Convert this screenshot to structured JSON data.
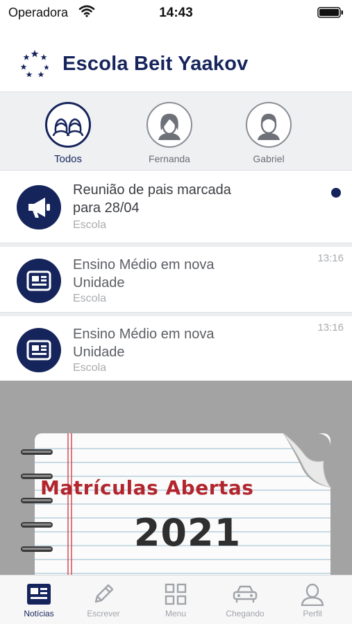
{
  "status_bar": {
    "carrier": "Operadora",
    "time": "14:43"
  },
  "header": {
    "title": "Escola Beit Yaakov",
    "logo_icon": "stars-logo-icon"
  },
  "filters": [
    {
      "label": "Todos",
      "icon": "group-avatar-icon",
      "active": true
    },
    {
      "label": "Fernanda",
      "icon": "girl-avatar-icon",
      "active": false
    },
    {
      "label": "Gabriel",
      "icon": "boy-avatar-icon",
      "active": false
    }
  ],
  "news": [
    {
      "title_line1": "Reunião de pais marcada",
      "title_line2": "para 28/04",
      "source": "Escola",
      "time": "",
      "icon": "megaphone-icon",
      "unread": true
    },
    {
      "title_line1": "Ensino Médio em nova",
      "title_line2": "Unidade",
      "source": "Escola",
      "time": "13:16",
      "icon": "newspaper-icon",
      "unread": false
    },
    {
      "title_line1": "Ensino Médio em nova",
      "title_line2": "Unidade",
      "source": "Escola",
      "time": "13:16",
      "icon": "newspaper-icon",
      "unread": false
    }
  ],
  "banner": {
    "heading": "Matrículas Abertas",
    "year": "2021"
  },
  "tabbar": [
    {
      "label": "Notícias",
      "icon": "news-icon",
      "active": true
    },
    {
      "label": "Escrever",
      "icon": "pencil-icon",
      "active": false
    },
    {
      "label": "Menu",
      "icon": "grid-icon",
      "active": false
    },
    {
      "label": "Chegando",
      "icon": "car-icon",
      "active": false
    },
    {
      "label": "Perfil",
      "icon": "person-icon",
      "active": false
    }
  ],
  "colors": {
    "brand": "#16245c",
    "muted_text": "#a9abaf",
    "banner_red": "#b2252d"
  }
}
